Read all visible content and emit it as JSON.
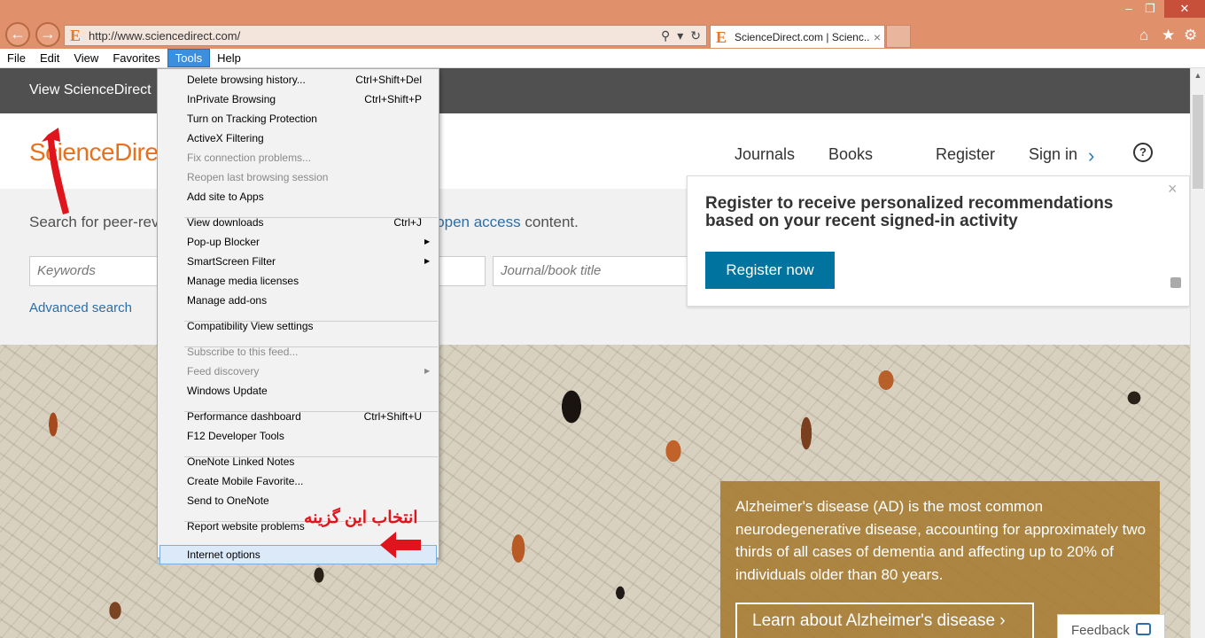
{
  "browser": {
    "address_url": "http://www.sciencedirect.com/",
    "tab_title": "ScienceDirect.com | Scienc...",
    "tab_close": "×",
    "back_glyph": "←",
    "forward_glyph": "→",
    "favicon": "E",
    "window_controls": [
      "–",
      "❐",
      "✕"
    ],
    "toolbar_icons": [
      "home-icon",
      "star-icon",
      "gear-icon"
    ]
  },
  "menubar": [
    "File",
    "Edit",
    "View",
    "Favorites",
    "Tools",
    "Help"
  ],
  "tools_menu": [
    {
      "label": "Delete browsing history...",
      "shortcut": "Ctrl+Shift+Del"
    },
    {
      "label": "InPrivate Browsing",
      "shortcut": "Ctrl+Shift+P"
    },
    {
      "label": "Turn on Tracking Protection"
    },
    {
      "label": "ActiveX Filtering"
    },
    {
      "label": "Fix connection problems...",
      "disabled": true
    },
    {
      "label": "Reopen last browsing session",
      "disabled": true
    },
    {
      "label": "Add site to Apps"
    },
    {
      "label": "View downloads",
      "shortcut": "Ctrl+J"
    },
    {
      "label": "Pop-up Blocker",
      "submenu": true
    },
    {
      "label": "SmartScreen Filter",
      "submenu": true
    },
    {
      "label": "Manage media licenses"
    },
    {
      "label": "Manage add-ons"
    },
    {
      "label": "Compatibility View settings"
    },
    {
      "label": "Subscribe to this feed...",
      "disabled": true
    },
    {
      "label": "Feed discovery",
      "disabled": true,
      "submenu": true
    },
    {
      "label": "Windows Update"
    },
    {
      "label": "Performance dashboard",
      "shortcut": "Ctrl+Shift+U"
    },
    {
      "label": "F12 Developer Tools"
    },
    {
      "label": "OneNote Linked Notes"
    },
    {
      "label": "Create Mobile Favorite..."
    },
    {
      "label": "Send to OneNote"
    },
    {
      "label": "Report website problems"
    },
    {
      "label": "Internet options",
      "highlighted": true
    }
  ],
  "sd": {
    "topbar_text": "View ScienceDirect",
    "logo": "ScienceDirect",
    "nav": [
      "Journals",
      "Books",
      "Register",
      "Sign in"
    ],
    "help": "?",
    "search_text": "Search for peer-rev",
    "search_text_right_prefix": "d ",
    "search_text_link": "open access",
    "search_text_right_suffix": " content.",
    "keywords_placeholder": "Keywords",
    "journal_placeholder": "Journal/book title",
    "advanced_search": "Advanced search"
  },
  "popup": {
    "title": "Register to receive personalized recommendations based on your recent signed-in activity",
    "button": "Register now",
    "close": "×"
  },
  "hero": {
    "text": "Alzheimer's disease (AD) is the most common neurodegenerative disease, accounting for approximately two thirds of all cases of dementia and affecting up to 20% of individuals older than 80 years.",
    "button": "Learn about Alzheimer's disease",
    "feedback": "Feedback"
  },
  "annotation": {
    "text": "انتخاب این گزینه",
    "color": "#e0141c"
  },
  "colors": {
    "titlebar": "#e0906b",
    "menu_active": "#3c8fdd",
    "sd_orange": "#e9711c",
    "sd_blue": "#00739e",
    "hero_box": "#a77c34"
  }
}
